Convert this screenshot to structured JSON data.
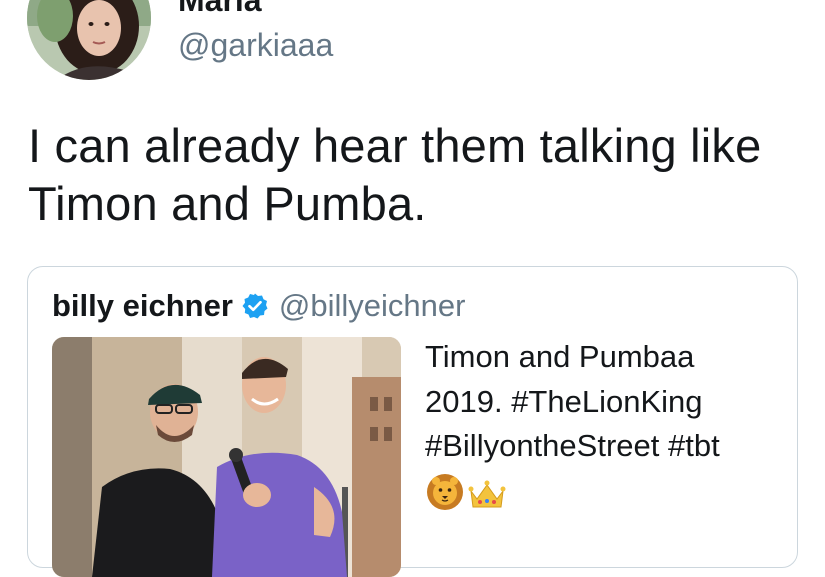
{
  "author": {
    "display_name": "Maria",
    "handle": "@garkiaaa"
  },
  "tweet": {
    "text": "I can already hear them talking like Timon and Pumba."
  },
  "quoted_tweet": {
    "author_name": "billy eichner",
    "author_handle": "@billyeichner",
    "verified": true,
    "text_line1": "Timon and Pumbaa",
    "text_line2": "2019. #TheLionKing",
    "text_line3": "#BillyontheStreet #tbt",
    "emojis": [
      "lion-face",
      "crown"
    ]
  },
  "colors": {
    "text_primary": "#14171a",
    "text_secondary": "#657786",
    "verified_blue": "#1da1f2",
    "card_border": "#ccd6dd"
  }
}
